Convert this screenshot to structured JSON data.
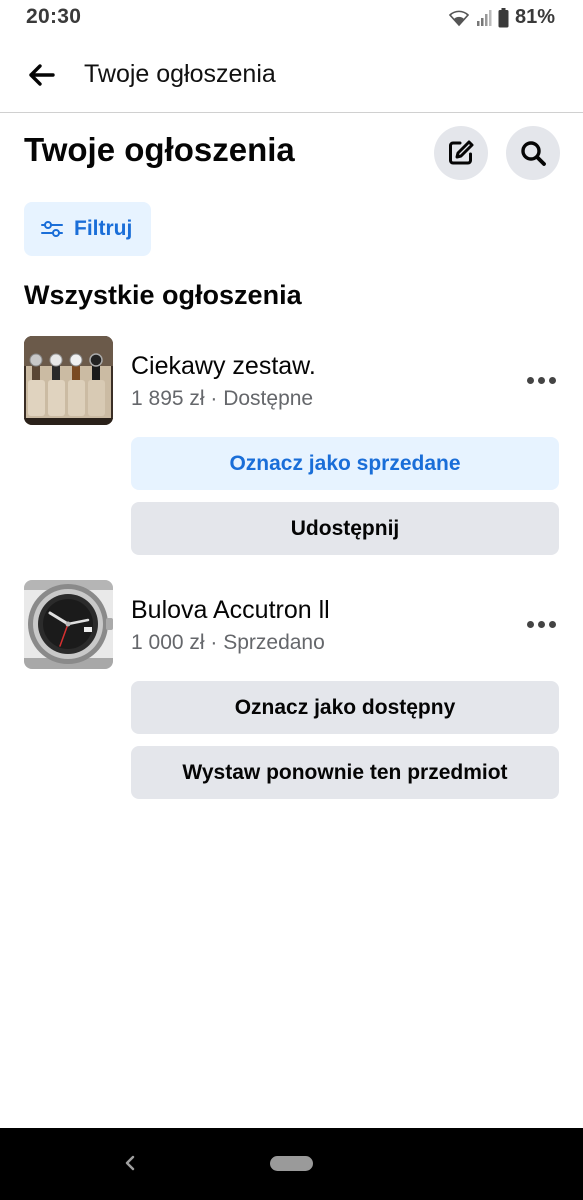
{
  "status_bar": {
    "time": "20:30",
    "battery": "81%",
    "icons": [
      "wifi-icon",
      "signal-icon",
      "battery-icon"
    ]
  },
  "app_bar": {
    "title": "Twoje ogłoszenia",
    "back_icon": "arrow-left-icon"
  },
  "header": {
    "title": "Twoje ogłoszenia",
    "edit_icon": "edit-icon",
    "search_icon": "search-icon"
  },
  "filter": {
    "label": "Filtruj",
    "icon": "sliders-icon"
  },
  "section": {
    "title": "Wszystkie ogłoszenia"
  },
  "listings": [
    {
      "title": "Ciekawy zestaw.",
      "subtitle": "1 895 zł · Dostępne",
      "thumbnail": "watch-box-image",
      "actions": [
        {
          "label": "Oznacz jako sprzedane",
          "style": "primary"
        },
        {
          "label": "Udostępnij",
          "style": "secondary"
        }
      ]
    },
    {
      "title": "Bulova Accutron ll",
      "subtitle": "1 000 zł · Sprzedano",
      "thumbnail": "watch-image",
      "actions": [
        {
          "label": "Oznacz jako dostępny",
          "style": "secondary"
        },
        {
          "label": "Wystaw ponownie ten przedmiot",
          "style": "secondary"
        }
      ]
    }
  ],
  "colors": {
    "accent": "#1a6ed8",
    "accent_bg": "#e7f3ff",
    "button_bg": "#e4e6eb",
    "secondary_text": "#65676b"
  },
  "nav_bar": {
    "back_icon": "nav-back-icon",
    "home_icon": "nav-home-pill"
  }
}
